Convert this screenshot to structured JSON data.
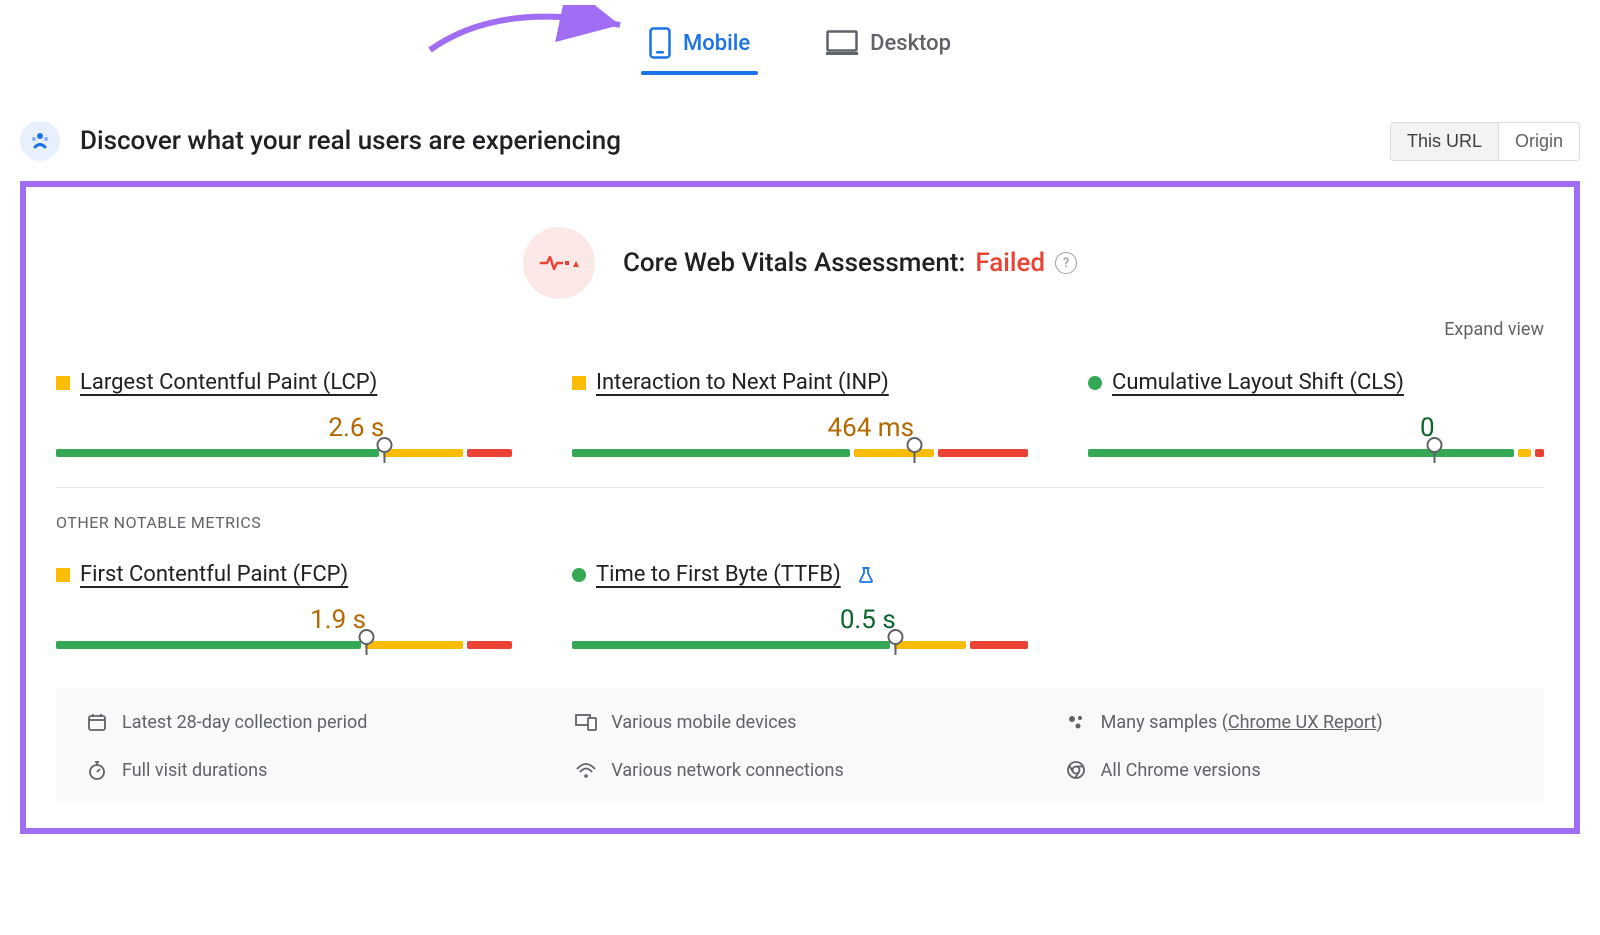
{
  "tabs": {
    "mobile": "Mobile",
    "desktop": "Desktop"
  },
  "header": {
    "title": "Discover what your real users are experiencing",
    "scope_this_url": "This URL",
    "scope_origin": "Origin"
  },
  "assessment": {
    "label": "Core Web Vitals Assessment:",
    "status": "Failed"
  },
  "expand_view": "Expand view",
  "metrics": {
    "lcp": {
      "name": "Largest Contentful Paint (LCP)",
      "value": "2.6 s",
      "status": "orange",
      "marker_pct": 72,
      "segs": [
        72,
        18,
        10
      ]
    },
    "inp": {
      "name": "Interaction to Next Paint (INP)",
      "value": "464 ms",
      "status": "orange",
      "marker_pct": 75,
      "segs": [
        62,
        18,
        20
      ]
    },
    "cls": {
      "name": "Cumulative Layout Shift (CLS)",
      "value": "0",
      "status": "green",
      "marker_pct": 76,
      "segs": [
        95,
        3,
        2
      ]
    }
  },
  "other_label": "OTHER NOTABLE METRICS",
  "other_metrics": {
    "fcp": {
      "name": "First Contentful Paint (FCP)",
      "value": "1.9 s",
      "status": "orange",
      "marker_pct": 68,
      "segs": [
        68,
        22,
        10
      ]
    },
    "ttfb": {
      "name": "Time to First Byte (TTFB)",
      "value": "0.5 s",
      "status": "green",
      "marker_pct": 71,
      "segs": [
        71,
        16,
        13
      ]
    }
  },
  "footer": {
    "collection_period": "Latest 28-day collection period",
    "devices": "Various mobile devices",
    "samples_prefix": "Many samples (",
    "samples_link": "Chrome UX Report",
    "samples_suffix": ")",
    "durations": "Full visit durations",
    "connections": "Various network connections",
    "versions": "All Chrome versions"
  }
}
